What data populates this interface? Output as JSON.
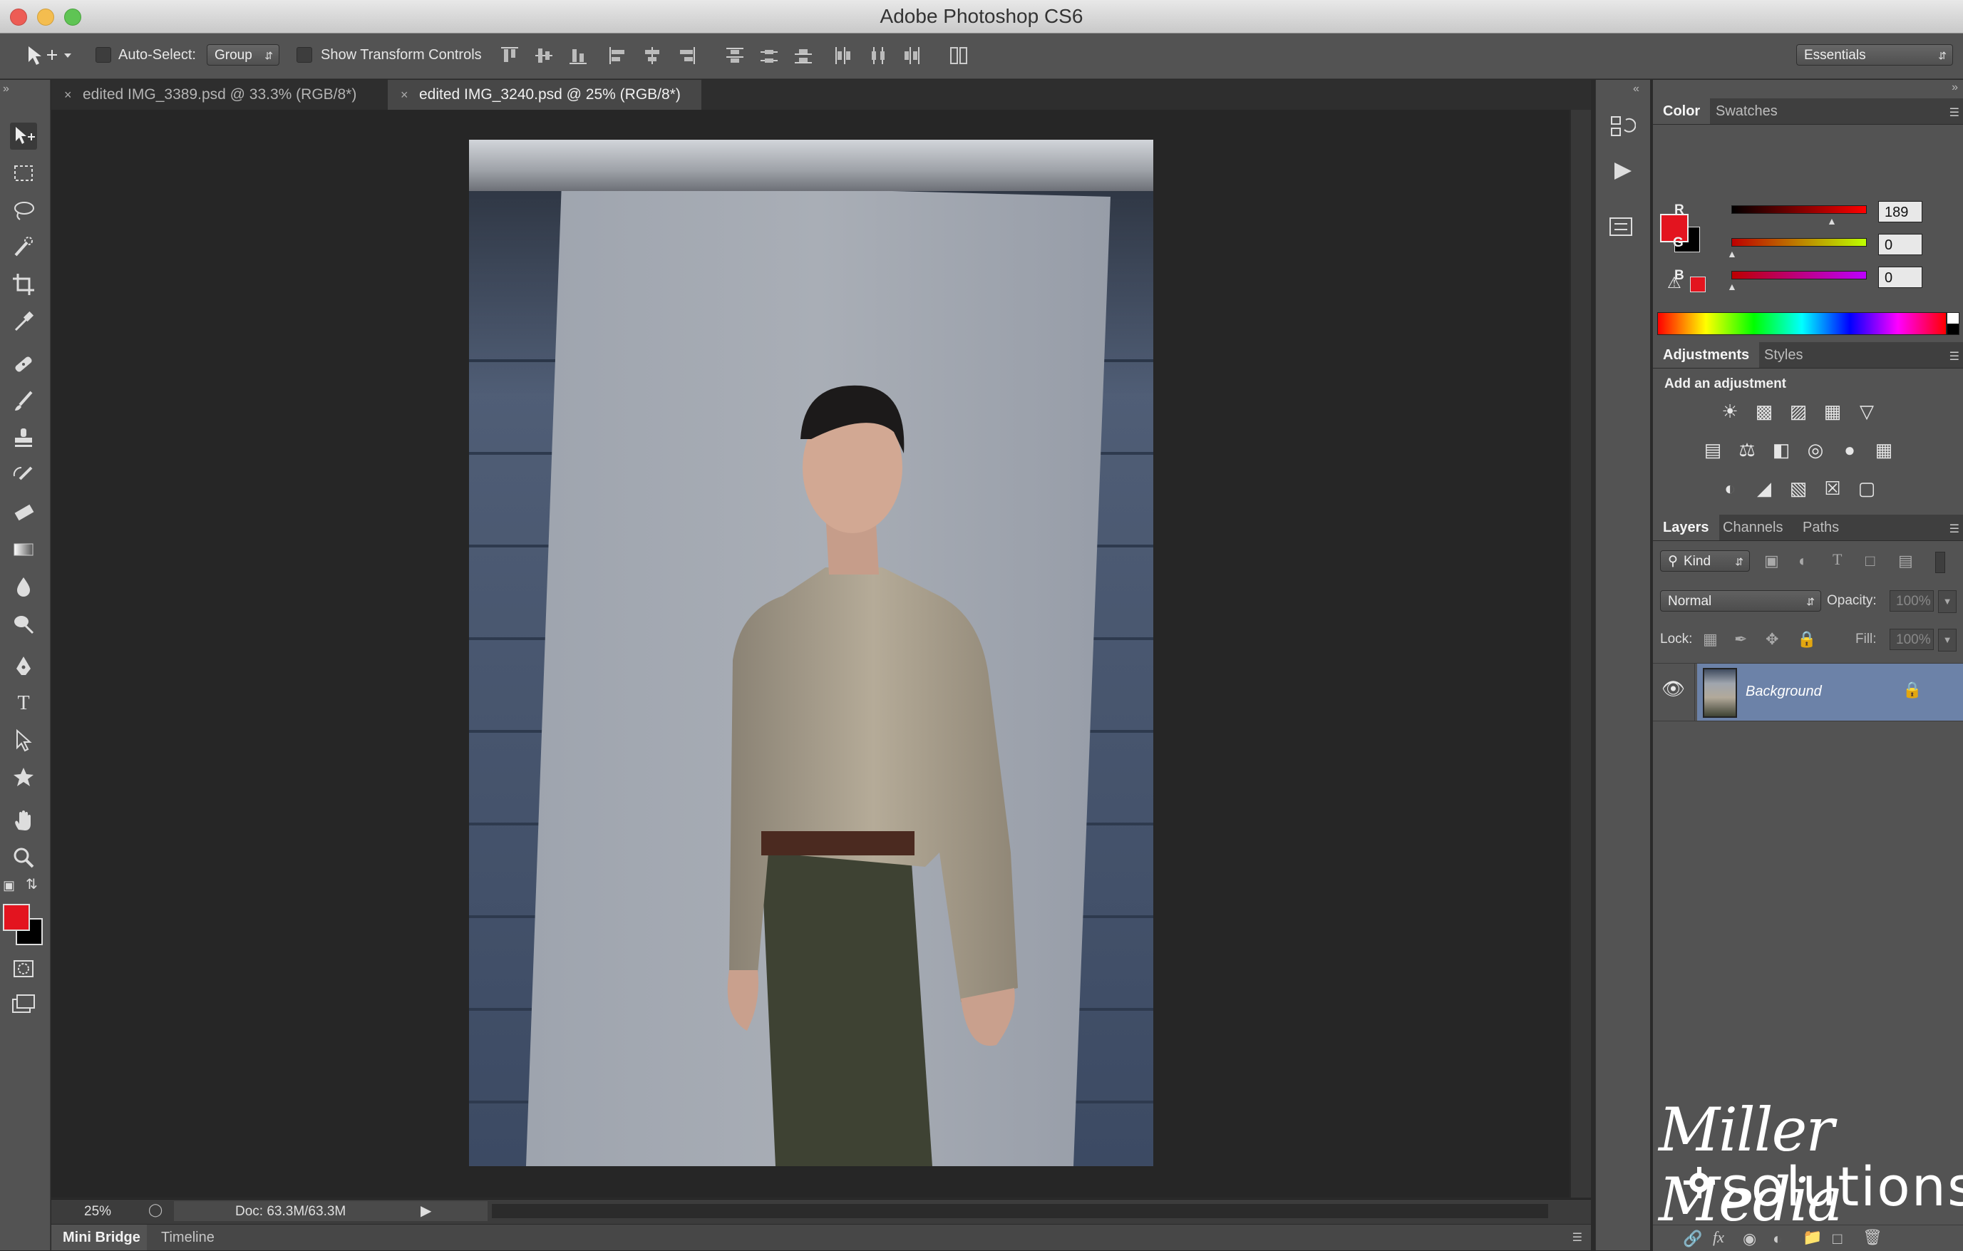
{
  "window": {
    "title": "Adobe Photoshop CS6"
  },
  "options_bar": {
    "auto_select_label": "Auto-Select:",
    "auto_select_value": "Group",
    "show_transform_label": "Show Transform Controls",
    "workspace": "Essentials"
  },
  "tabs": [
    {
      "label": "edited IMG_3389.psd @ 33.3% (RGB/8*)",
      "active": false
    },
    {
      "label": "edited IMG_3240.psd @ 25% (RGB/8*)",
      "active": true
    }
  ],
  "status": {
    "zoom": "25%",
    "doc": "Doc: 63.3M/63.3M"
  },
  "bottom_panels": [
    "Mini Bridge",
    "Timeline"
  ],
  "color_panel": {
    "tabs": [
      "Color",
      "Swatches"
    ],
    "r_label": "R",
    "g_label": "G",
    "b_label": "B",
    "r": "189",
    "g": "0",
    "b": "0",
    "fg_color": "#e3141f",
    "bg_color": "#000000"
  },
  "adjustments_panel": {
    "tabs": [
      "Adjustments",
      "Styles"
    ],
    "heading": "Add an adjustment",
    "icons_row1": [
      "brightness-contrast-icon",
      "levels-icon",
      "curves-icon",
      "exposure-icon",
      "vibrance-icon"
    ],
    "icons_row2": [
      "hue-saturation-icon",
      "color-balance-icon",
      "black-white-icon",
      "photo-filter-icon",
      "channel-mixer-icon",
      "color-lookup-icon"
    ],
    "icons_row3": [
      "invert-icon",
      "posterize-icon",
      "threshold-icon",
      "selective-color-icon",
      "gradient-map-icon"
    ]
  },
  "layers_panel": {
    "tabs": [
      "Layers",
      "Channels",
      "Paths"
    ],
    "filter_label": "Kind",
    "blend_mode": "Normal",
    "opacity_label": "Opacity:",
    "opacity_value": "100%",
    "lock_label": "Lock:",
    "fill_label": "Fill:",
    "fill_value": "100%",
    "layers": [
      {
        "name": "Background",
        "visible": true,
        "locked": true
      }
    ]
  },
  "watermark": {
    "line1": "Miller Media",
    "line2": "solutions"
  }
}
